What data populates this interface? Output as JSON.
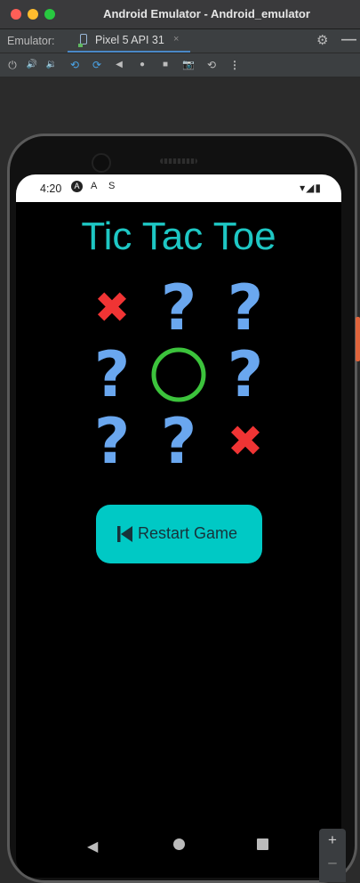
{
  "window": {
    "title": "Android Emulator - Android_emulator"
  },
  "tabs": {
    "prefix": "Emulator:",
    "device_tab": "Pixel 5 API 31",
    "close_glyph": "×"
  },
  "toolbar": {
    "icons": [
      "power-icon",
      "volume-up-icon",
      "volume-down-icon",
      "rotate-left-icon",
      "rotate-right-icon",
      "back-icon",
      "home-icon",
      "overview-icon",
      "screenshot-icon",
      "snapshot-icon",
      "more-icon"
    ],
    "glyphs": [
      "⏻",
      "🔊",
      "🔉",
      "⟲",
      "⟳",
      "◀",
      "●",
      "■",
      "📷",
      "⟲",
      "⋮"
    ]
  },
  "status_bar": {
    "time": "4:20",
    "icons": [
      "A",
      "A",
      "S"
    ],
    "right": "▾◢▮"
  },
  "app": {
    "title": "Tic Tac Toe",
    "board": [
      "x",
      "?",
      "?",
      "?",
      "o",
      "?",
      "?",
      "?",
      "x"
    ],
    "restart_label": "Restart Game"
  },
  "colors": {
    "title": "#1ec7c4",
    "question": "#6aa7ef",
    "x": "#f03434",
    "o": "#3cc33c",
    "button": "#00c9c5"
  },
  "zoom": {
    "plus": "+",
    "minus": "–"
  }
}
